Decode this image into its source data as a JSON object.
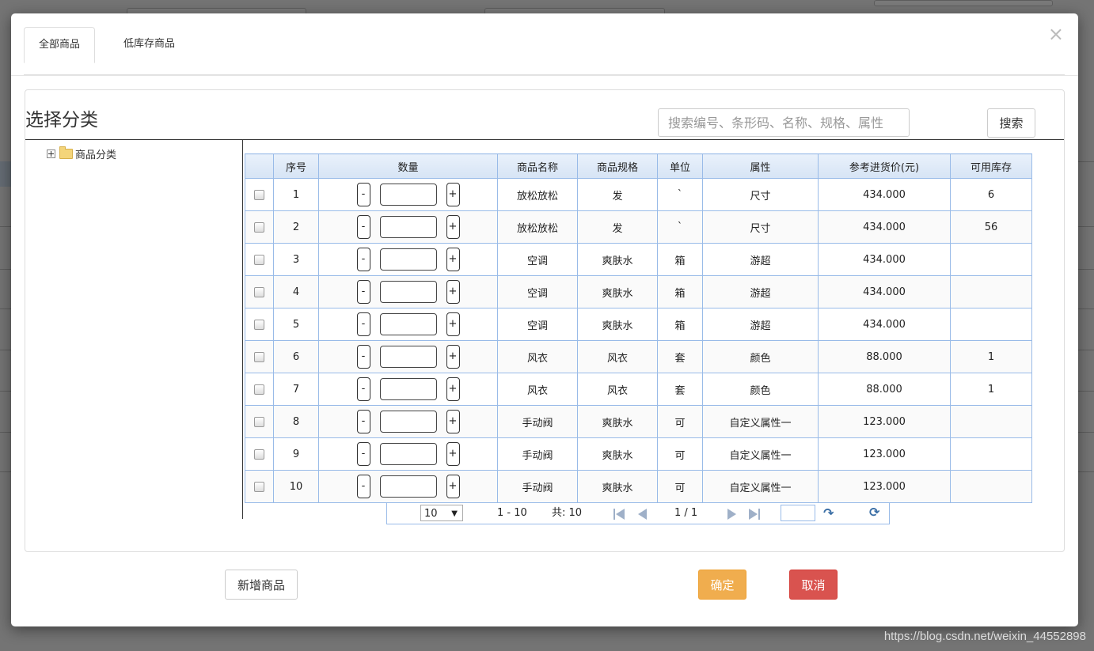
{
  "tabs": [
    {
      "label": "全部商品",
      "active": true
    },
    {
      "label": "低库存商品",
      "active": false
    }
  ],
  "close_label": "×",
  "section_title": "选择分类",
  "search": {
    "placeholder": "搜索编号、条形码、名称、规格、属性",
    "value": "",
    "button_label": "搜索"
  },
  "tree": {
    "root_label": "商品分类",
    "icon": "folder-icon"
  },
  "grid": {
    "columns": [
      "",
      "序号",
      "数量",
      "商品名称",
      "商品规格",
      "单位",
      "属性",
      "参考进货价(元)",
      "可用库存"
    ],
    "minus_label": "-",
    "plus_label": "+",
    "rows": [
      {
        "no": "1",
        "name": "放松放松",
        "spec": "发",
        "unit": "`",
        "attr": "尺寸",
        "price": "434.000",
        "stock": "6"
      },
      {
        "no": "2",
        "name": "放松放松",
        "spec": "发",
        "unit": "`",
        "attr": "尺寸",
        "price": "434.000",
        "stock": "56"
      },
      {
        "no": "3",
        "name": "空调",
        "spec": "爽肤水",
        "unit": "箱",
        "attr": "游超",
        "price": "434.000",
        "stock": ""
      },
      {
        "no": "4",
        "name": "空调",
        "spec": "爽肤水",
        "unit": "箱",
        "attr": "游超",
        "price": "434.000",
        "stock": ""
      },
      {
        "no": "5",
        "name": "空调",
        "spec": "爽肤水",
        "unit": "箱",
        "attr": "游超",
        "price": "434.000",
        "stock": ""
      },
      {
        "no": "6",
        "name": "风衣",
        "spec": "风衣",
        "unit": "套",
        "attr": "颜色",
        "price": "88.000",
        "stock": "1"
      },
      {
        "no": "7",
        "name": "风衣",
        "spec": "风衣",
        "unit": "套",
        "attr": "颜色",
        "price": "88.000",
        "stock": "1"
      },
      {
        "no": "8",
        "name": "手动阀",
        "spec": "爽肤水",
        "unit": "可",
        "attr": "自定义属性一",
        "price": "123.000",
        "stock": ""
      },
      {
        "no": "9",
        "name": "手动阀",
        "spec": "爽肤水",
        "unit": "可",
        "attr": "自定义属性一",
        "price": "123.000",
        "stock": ""
      },
      {
        "no": "10",
        "name": "手动阀",
        "spec": "爽肤水",
        "unit": "可",
        "attr": "自定义属性一",
        "price": "123.000",
        "stock": ""
      }
    ]
  },
  "pager": {
    "page_size": "10",
    "range": "1 - 10",
    "total": "共: 10",
    "page_info": "1 / 1"
  },
  "footer": {
    "add_label": "新增商品",
    "confirm_label": "确定",
    "cancel_label": "取消"
  },
  "watermark": "https://blog.csdn.net/weixin_44552898",
  "colors": {
    "confirm": "#f0ad4e",
    "cancel": "#d9534f",
    "grid_border": "#99bbe8"
  }
}
